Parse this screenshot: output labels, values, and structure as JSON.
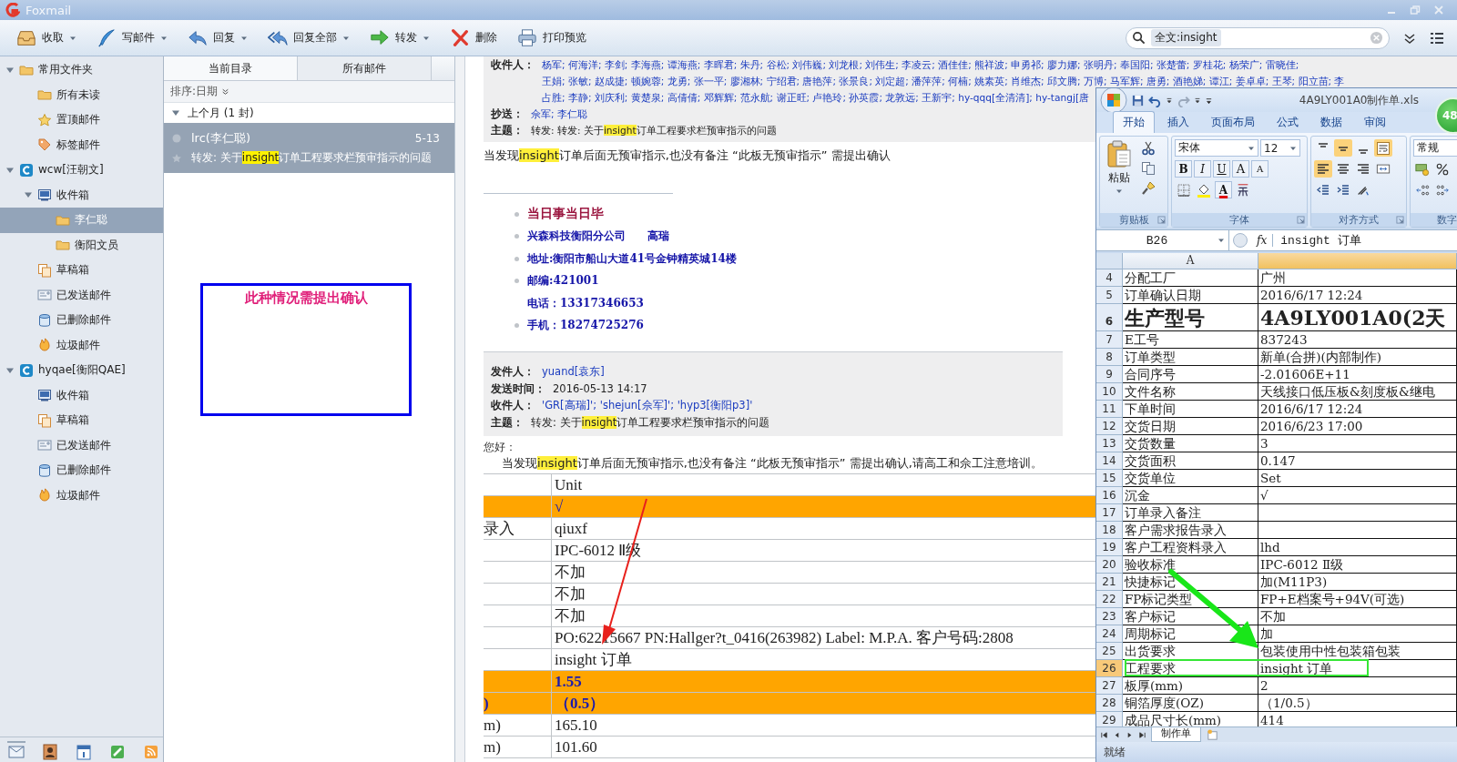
{
  "window": {
    "title": "Foxmail"
  },
  "toolbar": [
    {
      "label": "收取",
      "kind": "receive",
      "has_menu": true
    },
    {
      "label": "写邮件",
      "kind": "compose",
      "has_menu": true
    },
    {
      "label": "回复",
      "kind": "reply",
      "has_menu": true
    },
    {
      "label": "回复全部",
      "kind": "reply_all",
      "has_menu": true
    },
    {
      "label": "转发",
      "kind": "forward",
      "has_menu": true
    },
    {
      "label": "删除",
      "kind": "delete",
      "has_menu": false
    },
    {
      "label": "打印预览",
      "kind": "print",
      "has_menu": false
    }
  ],
  "search": {
    "token": "全文:insight"
  },
  "sidebar": {
    "tree": [
      {
        "label": "常用文件夹",
        "kind": "folder",
        "expanded": true,
        "selected": false,
        "children": [
          {
            "label": "所有未读",
            "kind": "folder",
            "selected": false
          },
          {
            "label": "置顶邮件",
            "kind": "star",
            "selected": false
          },
          {
            "label": "标签邮件",
            "kind": "tag",
            "selected": false
          }
        ]
      },
      {
        "label": "wcw[汪朝文]",
        "kind": "account",
        "expanded": true,
        "selected": false,
        "children": [
          {
            "label": "收件箱",
            "kind": "inbox",
            "expanded": true,
            "selected": false,
            "children": [
              {
                "label": "李仁聪",
                "kind": "folder",
                "selected": true
              },
              {
                "label": "衡阳文员",
                "kind": "folder",
                "selected": false
              }
            ]
          },
          {
            "label": "草稿箱",
            "kind": "drafts",
            "selected": false
          },
          {
            "label": "已发送邮件",
            "kind": "sent",
            "selected": false
          },
          {
            "label": "已删除邮件",
            "kind": "trash",
            "selected": false
          },
          {
            "label": "垃圾邮件",
            "kind": "junk",
            "selected": false
          }
        ]
      },
      {
        "label": "hyqae[衡阳QAE]",
        "kind": "account",
        "expanded": true,
        "selected": false,
        "children": [
          {
            "label": "收件箱",
            "kind": "inbox",
            "selected": false
          },
          {
            "label": "草稿箱",
            "kind": "drafts",
            "selected": false
          },
          {
            "label": "已发送邮件",
            "kind": "sent",
            "selected": false
          },
          {
            "label": "已删除邮件",
            "kind": "trash",
            "selected": false
          },
          {
            "label": "垃圾邮件",
            "kind": "junk",
            "selected": false
          }
        ]
      }
    ],
    "nav": [
      {
        "kind": "mail",
        "selected": true
      },
      {
        "kind": "contacts",
        "selected": false
      },
      {
        "kind": "calendar",
        "selected": false
      },
      {
        "kind": "notes",
        "selected": false
      },
      {
        "kind": "rss",
        "selected": false
      }
    ]
  },
  "mail_list": {
    "tabs": [
      {
        "label": "当前目录",
        "selected": true
      },
      {
        "label": "所有邮件",
        "selected": false
      }
    ],
    "sort": "排序:日期",
    "groups": [
      {
        "label": "上个月 (1 封)",
        "expanded": true,
        "items": [
          {
            "sender": "lrc(李仁聪)",
            "date": "5-13",
            "selected": true,
            "subject": [
              {
                "text": "转发: 关于"
              },
              {
                "text": "insight",
                "highlight": true
              },
              {
                "text": "订单工程要求栏预审指示的问题"
              }
            ]
          }
        ]
      }
    ]
  },
  "annotation": {
    "text": "此种情况需提出确认"
  },
  "reader": {
    "quoted_header": [
      {
        "label": "收件人：",
        "kind": "recipients",
        "lines": [
          "杨军; 何海洋; 李剑; 李海燕; 谭海燕; 李晖君; 朱丹; 谷松; 刘伟巍; 刘龙根; 刘伟生; 李凌云; 酒佳佳; 熊祥波; 申勇祁; 廖力娜; 张明丹; 奉国阳; 张楚蕾; 罗桂花; 杨荣广; 雷晓佳;",
          "王娟; 张敏; 赵成捷; 顿婉蓉; 龙勇; 张一平; 廖湘林; 宁绍君; 唐艳萍; 张景良; 刘定超; 潘萍萍; 何楠; 姚素英; 肖维杰; 邱文腾; 万博; 马军辉; 唐勇; 酒艳娣; 谭江; 姜卓卓; 王琴; 阳立苗; 李",
          "占胜; 李静; 刘庆利; 黄楚泉; 高倩倩; 邓辉辉; 范永航; 谢正旺; 卢艳玲; 孙英霞; 龙敦远; 王新宇; hy-qqq[全清清]; hy-tangj[唐"
        ]
      },
      {
        "label": "抄送：",
        "kind": "recipients",
        "lines": [
          "佘军; 李仁聪"
        ]
      },
      {
        "label": "主题：",
        "kind": "plain",
        "parts": [
          {
            "text": "转发: 转发: 关于"
          },
          {
            "text": "insight",
            "highlight": true
          },
          {
            "text": "订单工程要求栏预审指示的问题"
          }
        ]
      }
    ],
    "first_body": [
      {
        "text": "当发现"
      },
      {
        "text": "insight",
        "highlight": true
      },
      {
        "text": "订单后面无预审指示,也没有备注 “此板无预审指示” 需提出确认"
      }
    ],
    "signature": [
      {
        "text": "当日事当日毕",
        "kind": "motto",
        "bullet": true
      },
      {
        "text": "兴森科技衡阳分公司　　高瑞",
        "kind": "line",
        "bullet": true
      },
      {
        "text": "地址:衡阳市船山大道41号金钟精英城14楼",
        "kind": "line",
        "bullet": true
      },
      {
        "text": "邮编:421001",
        "kind": "line",
        "bullet": true
      },
      {
        "text": "电话：13317346653",
        "kind": "line",
        "bullet": false
      },
      {
        "text": "手机：18274725276",
        "kind": "line",
        "bullet": true
      }
    ],
    "header": [
      {
        "label": "发件人：",
        "kind": "recipients",
        "lines": [
          "yuand[袁东]"
        ]
      },
      {
        "label": "发送时间：",
        "kind": "plain",
        "lines": [
          "2016-05-13 14:17"
        ]
      },
      {
        "label": "收件人：",
        "kind": "recipients",
        "lines": [
          "'GR[高瑞]'; 'shejun[佘军]'; 'hyp3[衡阳p3]'"
        ]
      },
      {
        "label": "主题：",
        "kind": "plain",
        "parts": [
          {
            "text": "转发: 关于"
          },
          {
            "text": "insight",
            "highlight": true
          },
          {
            "text": "订单工程要求栏预审指示的问题"
          }
        ]
      }
    ],
    "greeting": "您好：",
    "body": [
      {
        "text": "当发现"
      },
      {
        "text": "insight",
        "highlight": true
      },
      {
        "text": "订单后面无预审指示,也没有备注 “此板无预审指示” 需提出确认,请高工和佘工注意培训。"
      }
    ],
    "table": [
      {
        "value": "Unit",
        "highlight": false
      },
      {
        "value": "√",
        "highlight": true
      },
      {
        "label": "录入",
        "value": "qiuxf",
        "highlight": false
      },
      {
        "value": "IPC-6012 Ⅱ级",
        "highlight": false
      },
      {
        "value": "不加",
        "highlight": false
      },
      {
        "value": "不加",
        "highlight": false
      },
      {
        "value": "不加",
        "highlight": false
      },
      {
        "value": "PO:62215667 PN:Hallger?t_0416(263982) Label: M.P.A. 客户号码:2808",
        "highlight": false
      },
      {
        "value": "insight 订单",
        "highlight": false
      },
      {
        "value": "1.55",
        "highlight": true
      },
      {
        "label": ")",
        "value": "（0.5）",
        "highlight": true
      },
      {
        "label": "m)",
        "value": "165.10",
        "highlight": false
      },
      {
        "label": "m)",
        "value": "101.60",
        "highlight": false
      }
    ]
  },
  "excel": {
    "title": "4A9LY001A0制作单.xls",
    "badge": "48",
    "tabs": [
      {
        "label": "开始",
        "selected": true
      },
      {
        "label": "插入",
        "selected": false
      },
      {
        "label": "页面布局",
        "selected": false
      },
      {
        "label": "公式",
        "selected": false
      },
      {
        "label": "数据",
        "selected": false
      },
      {
        "label": "审阅",
        "selected": false
      }
    ],
    "groups": [
      "剪贴板",
      "字体",
      "对齐方式",
      "数字"
    ],
    "paste": "粘贴",
    "font_name": "宋体",
    "font_size": "12",
    "font_buttons": [
      "B",
      "I",
      "U",
      "A",
      "A"
    ],
    "font_color": "A",
    "number_format": "常规",
    "name_box": "B26",
    "fx": "fx",
    "formula": "insight 订单",
    "columns": [
      {
        "label": "A",
        "selected": false
      },
      {
        "selected": true
      }
    ],
    "rows": [
      {
        "num": "4",
        "a": "分配工厂",
        "b": "广州",
        "selected": false
      },
      {
        "num": "5",
        "a": "订单确认日期",
        "b": "2016/6/17 12:24",
        "selected": false
      },
      {
        "num": "6",
        "a": "生产型号",
        "b": "4A9LY001A0(2天",
        "kind": "large",
        "selected": false
      },
      {
        "num": "7",
        "a": "E工号",
        "b": "837243",
        "selected": false
      },
      {
        "num": "8",
        "a": "订单类型",
        "b": "新单(合拼)(内部制作)",
        "selected": false
      },
      {
        "num": "9",
        "a": "合同序号",
        "b": "-2.01606E+11",
        "selected": false
      },
      {
        "num": "10",
        "a": "文件名称",
        "b": "天线接口低压板&刻度板&继电",
        "selected": false
      },
      {
        "num": "11",
        "a": "下单时间",
        "b": "2016/6/17 12:24",
        "selected": false
      },
      {
        "num": "12",
        "a": "交货日期",
        "b": "2016/6/23 17:00",
        "selected": false
      },
      {
        "num": "13",
        "a": "交货数量",
        "b": "3",
        "selected": false
      },
      {
        "num": "14",
        "a": "交货面积",
        "b": "0.147",
        "selected": false
      },
      {
        "num": "15",
        "a": "交货单位",
        "b": "Set",
        "selected": false
      },
      {
        "num": "16",
        "a": "沉金",
        "b": "√",
        "selected": false
      },
      {
        "num": "17",
        "a": "订单录入备注",
        "selected": false
      },
      {
        "num": "18",
        "a": "客户需求报告录入",
        "selected": false
      },
      {
        "num": "19",
        "a": "客户工程资料录入",
        "b": "lhd",
        "selected": false
      },
      {
        "num": "20",
        "a": "验收标准",
        "b": "IPC-6012 Ⅱ级",
        "selected": false
      },
      {
        "num": "21",
        "a": "快捷标记",
        "b": "加(M11P3)",
        "selected": false
      },
      {
        "num": "22",
        "a": "FP标记类型",
        "b": "FP+E档案号+94V(可选)",
        "selected": false
      },
      {
        "num": "23",
        "a": "客户标记",
        "b": "不加",
        "selected": false
      },
      {
        "num": "24",
        "a": "周期标记",
        "b": "加",
        "selected": false
      },
      {
        "num": "25",
        "a": "出货要求",
        "b": "包装使用中性包装箱包装",
        "selected": false
      },
      {
        "num": "26",
        "a": "工程要求",
        "b": "insight 订单",
        "selected": true
      },
      {
        "num": "27",
        "a": "板厚(mm)",
        "b": "2",
        "selected": false
      },
      {
        "num": "28",
        "a": "铜箔厚度(OZ)",
        "b": "（1/0.5）",
        "selected": false
      },
      {
        "num": "29",
        "a": "成品尺寸长(mm)",
        "b": "414",
        "selected": false
      }
    ],
    "sheet_tabs": [
      {
        "label": "制作单",
        "selected": true
      }
    ],
    "status": "就绪"
  }
}
